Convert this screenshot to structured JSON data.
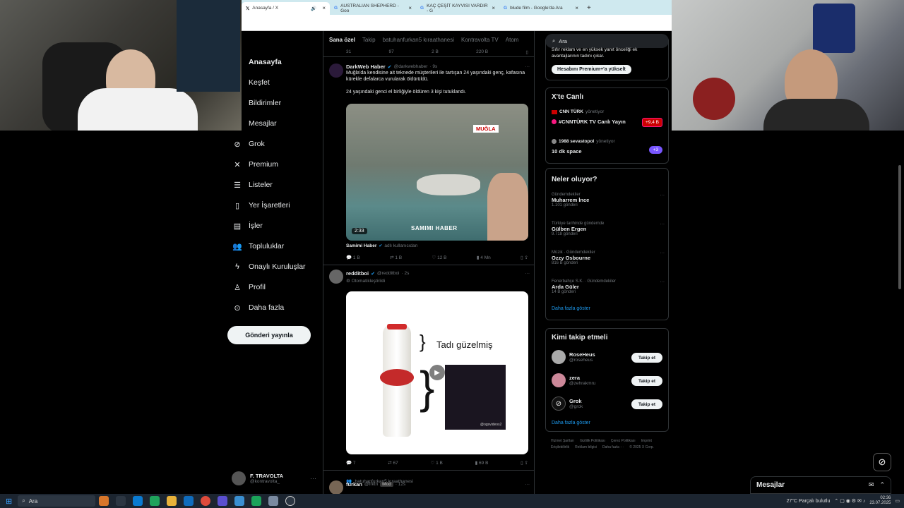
{
  "browser": {
    "tabs": [
      {
        "label": "Anasayfa / X",
        "active": true
      },
      {
        "label": "AUSTRALIAN SHEPHERD - Goo",
        "active": false
      },
      {
        "label": "KAÇ ÇEŞİT KAYVISI VARDIR - G",
        "active": false
      },
      {
        "label": "blude film - Google'da Ara",
        "active": false
      }
    ]
  },
  "sidebar": {
    "items": [
      {
        "label": "Anasayfa",
        "icon": "home-icon"
      },
      {
        "label": "Keşfet",
        "icon": "search-icon"
      },
      {
        "label": "Bildirimler",
        "icon": "bell-icon"
      },
      {
        "label": "Mesajlar",
        "icon": "mail-icon"
      },
      {
        "label": "Grok",
        "icon": "grok-icon"
      },
      {
        "label": "Premium",
        "icon": "x-icon"
      },
      {
        "label": "Listeler",
        "icon": "list-icon"
      },
      {
        "label": "Yer İşaretleri",
        "icon": "bookmark-icon"
      },
      {
        "label": "İşler",
        "icon": "briefcase-icon"
      },
      {
        "label": "Topluluklar",
        "icon": "people-icon"
      },
      {
        "label": "Onaylı Kuruluşlar",
        "icon": "lightning-icon"
      },
      {
        "label": "Profil",
        "icon": "person-icon"
      },
      {
        "label": "Daha fazla",
        "icon": "more-circle-icon"
      }
    ],
    "post_button": "Gönderi yayınla",
    "account": {
      "name": "F. TRAVOLTA",
      "handle": "@kontravolta_",
      "more": "···"
    }
  },
  "feed": {
    "tabs": [
      "Sana özel",
      "Takip",
      "batuhanfurkan5 kıraathanesi",
      "Kontravolta TV",
      "Atom"
    ],
    "top_counts": [
      "31",
      "97",
      "2 B",
      "220 B"
    ],
    "posts": [
      {
        "author": "DarkWeb Haber",
        "handle": "@darkwebhaber",
        "time": "· 9s",
        "text1": "Muğla'da kendisine ait teknede müşterileri ile tartışan 24 yaşındaki genç, kafasına kürekle defalarca vurularak öldürüldü.",
        "text2": "24 yaşındaki genci el birliğiyle öldüren 3 kişi tutuklandı.",
        "video_tag": "MUĞLA",
        "watermark": "SAMIMI HABER",
        "duration": "2:33",
        "source_name": "Samimi Haber",
        "source_note": "adlı kullanıcıdan",
        "counts": {
          "replies": "1 B",
          "reposts": "1 B",
          "likes": "12 B",
          "views": "4 Mn"
        }
      },
      {
        "author": "redditboi",
        "handle": "@redditboi",
        "time": "· 2s",
        "note": "Otomatikleştirildi",
        "image_text": "Tadı güzelmiş",
        "image_watermark": "@ogsvideos2",
        "counts": {
          "replies": "7",
          "reposts": "67",
          "likes": "1 B",
          "views": "69 B"
        }
      },
      {
        "context": "batuhanfurkan5 kıraathanesi",
        "author": "furkan",
        "handle": "@frktn",
        "badge": "Mod",
        "time": "· 12s"
      }
    ]
  },
  "right": {
    "search_placeholder": "Ara",
    "premium_text": "Sıfır reklam ve en yüksek yanıt önceliği ek avantajlarının tadını çıkar.",
    "premium_button": "Hesabını Premium+'a yükselt",
    "live": {
      "title": "X'te Canlı",
      "items": [
        {
          "host": "CNN TÜRK",
          "status": "yönetiyor",
          "title": "#CNNTÜRK TV Canlı Yayın",
          "badge": "+9,4 B"
        },
        {
          "host": "1988 sevastopol",
          "status": "yönetiyor",
          "title": "10 dk space",
          "badge": "+3"
        }
      ]
    },
    "trends": {
      "title": "Neler oluyor?",
      "items": [
        {
          "category": "Gündemdekiler",
          "name": "Muharrem İnce",
          "count": "1.101 gönderi"
        },
        {
          "category": "Türkiye tarihinde gündemde",
          "name": "Gülben Ergen",
          "count": "9.718 gönderi"
        },
        {
          "category": "Müzik · Gündemdekiler",
          "name": "Ozzy Osbourne",
          "count": "816 B gönderi"
        },
        {
          "category": "Fenerbahçe S.K. · Gündemdekiler",
          "name": "Arda Güler",
          "count": "14 B gönderi"
        }
      ],
      "more": "Daha fazla göster"
    },
    "follow": {
      "title": "Kimi takip etmeli",
      "items": [
        {
          "name": "RoseHeus",
          "handle": "@roseheus",
          "button": "Takip et"
        },
        {
          "name": "zera",
          "handle": "@zehrakmru",
          "button": "Takip et"
        },
        {
          "name": "Grok",
          "handle": "@grok",
          "button": "Takip et"
        }
      ],
      "more": "Daha fazla göster"
    },
    "footer": [
      "Hizmet Şartları",
      "Gizlilik Politikası",
      "Çerez Politikası",
      "Imprint",
      "Erişilebilirlik",
      "Reklam bilgisi",
      "Daha fazla ···",
      "© 2025 X Corp."
    ]
  },
  "messages_drawer": {
    "title": "Mesajlar"
  },
  "taskbar": {
    "search": "Ara",
    "weather": "27°C  Parçalı bulutlu",
    "time": "02:36",
    "date": "23.07.2025"
  },
  "colors": {
    "accent": "#1d9bf0",
    "background": "#000000",
    "border": "#2f3336"
  }
}
